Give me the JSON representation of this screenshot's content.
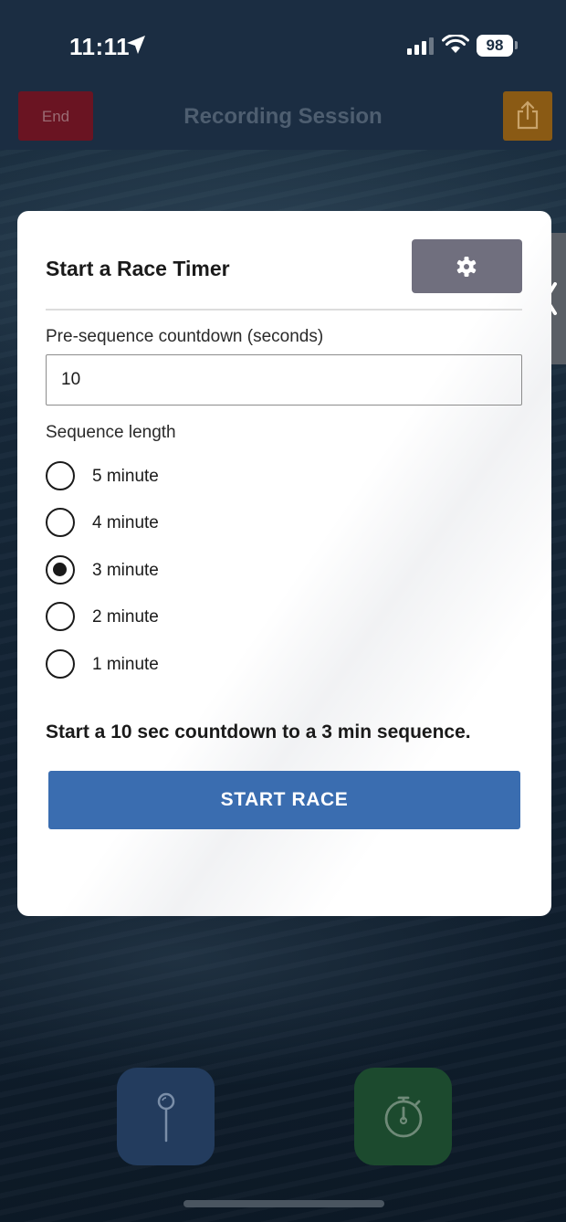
{
  "status_bar": {
    "time": "11:11",
    "battery": "98",
    "icons": [
      "location-arrow-icon",
      "signal-icon",
      "wifi-icon"
    ]
  },
  "nav": {
    "end_label": "End",
    "title": "Recording Session",
    "share_icon": "share-icon"
  },
  "modal": {
    "title": "Start a Race Timer",
    "settings_icon": "gear-icon",
    "countdown_label": "Pre-sequence countdown (seconds)",
    "countdown_value": "10",
    "sequence_label": "Sequence length",
    "options": [
      {
        "label": "5 minute",
        "checked": false
      },
      {
        "label": "4 minute",
        "checked": false
      },
      {
        "label": "3 minute",
        "checked": true
      },
      {
        "label": "2 minute",
        "checked": false
      },
      {
        "label": "1 minute",
        "checked": false
      }
    ],
    "summary": "Start a 10 sec countdown to a 3 min sequence.",
    "start_label": "START RACE"
  },
  "drawer": {
    "icon": "chevron-left-icon"
  },
  "bottom": {
    "pin_icon": "map-pin-icon",
    "timer_icon": "stopwatch-icon"
  },
  "colors": {
    "end_button": "#6a1422",
    "share_button": "#8a5a14",
    "start_button": "#3a6db0",
    "settings_button": "#706f7e",
    "pin_button": "#233c5e",
    "timer_button": "#1c4a2e"
  }
}
